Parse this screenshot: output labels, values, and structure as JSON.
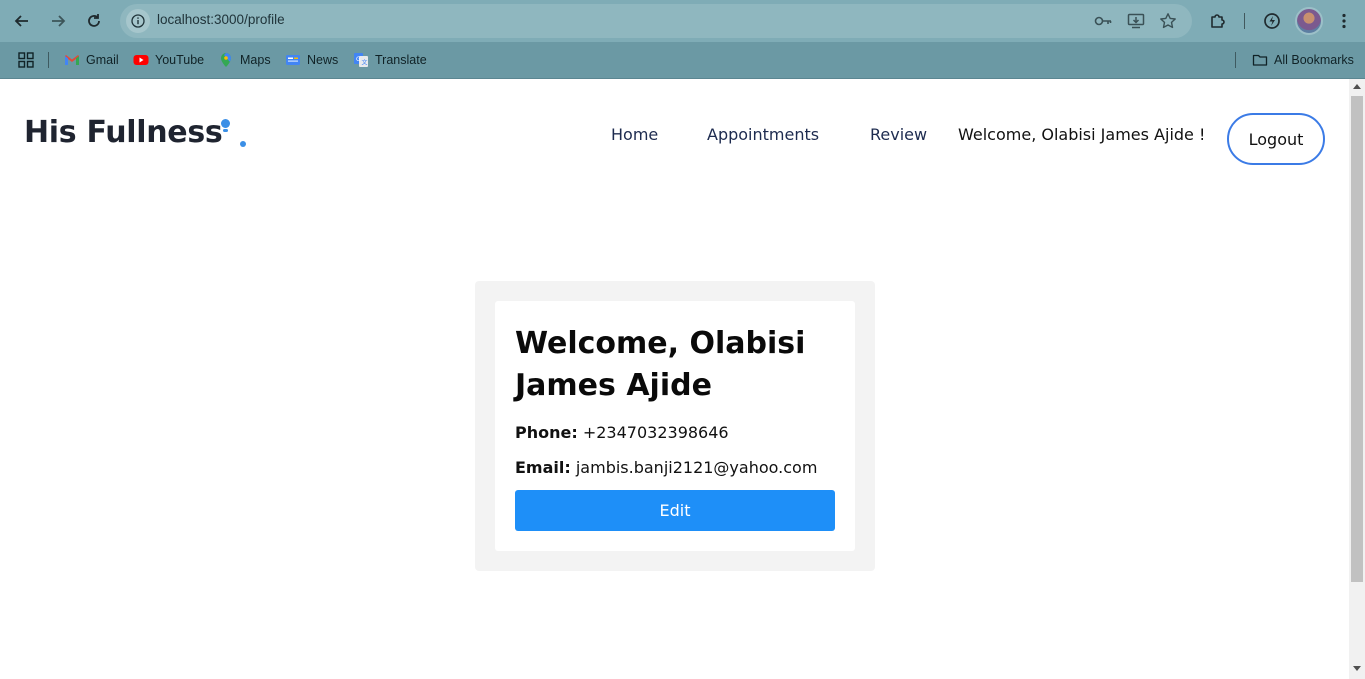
{
  "browser": {
    "url": "localhost:3000/profile",
    "bookmarks": [
      {
        "label": "Gmail",
        "icon": "gmail-icon"
      },
      {
        "label": "YouTube",
        "icon": "youtube-icon"
      },
      {
        "label": "Maps",
        "icon": "maps-icon"
      },
      {
        "label": "News",
        "icon": "news-icon"
      },
      {
        "label": "Translate",
        "icon": "translate-icon"
      }
    ],
    "all_bookmarks_label": "All Bookmarks"
  },
  "header": {
    "logo_text": "His Fullness",
    "nav": [
      {
        "label": "Home"
      },
      {
        "label": "Appointments"
      },
      {
        "label": "Review"
      }
    ],
    "welcome_text": "Welcome, Olabisi James Ajide !",
    "logout_label": "Logout"
  },
  "profile": {
    "title": "Welcome, Olabisi James Ajide",
    "phone_label": "Phone:",
    "phone_value": "+2347032398646",
    "email_label": "Email:",
    "email_value": "jambis.banji2121@yahoo.com",
    "edit_label": "Edit"
  },
  "colors": {
    "accent": "#1e8ff8",
    "logout_border": "#3b7be6",
    "chrome": "#7facb6"
  }
}
